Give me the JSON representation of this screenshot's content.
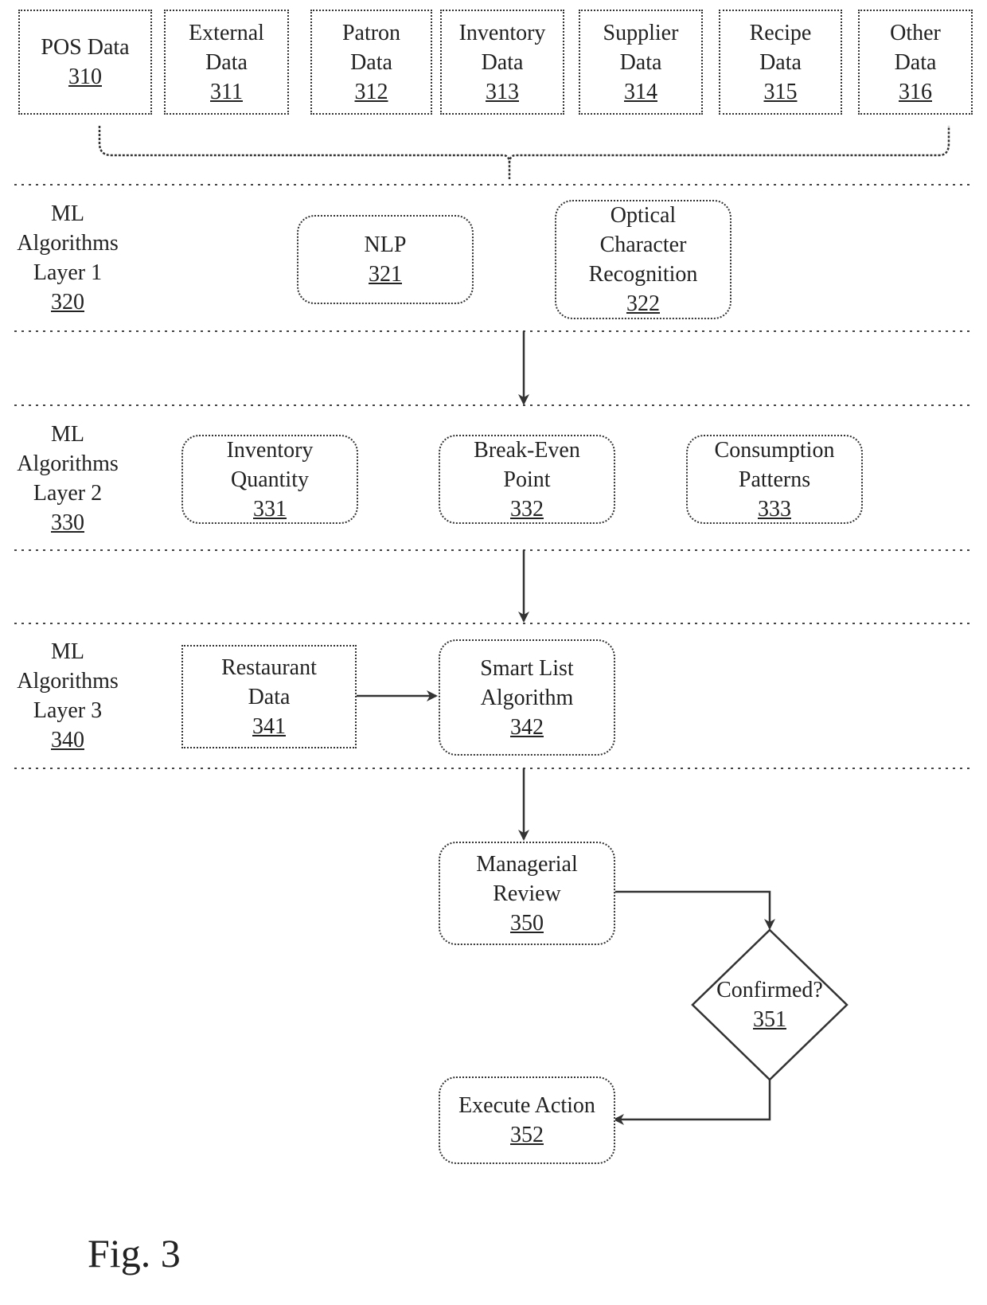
{
  "data_sources": [
    {
      "label": "POS Data",
      "ref": "310"
    },
    {
      "label": "External Data",
      "ref": "311"
    },
    {
      "label": "Patron Data",
      "ref": "312"
    },
    {
      "label": "Inventory Data",
      "ref": "313"
    },
    {
      "label": "Supplier Data",
      "ref": "314"
    },
    {
      "label": "Recipe Data",
      "ref": "315"
    },
    {
      "label": "Other Data",
      "ref": "316"
    }
  ],
  "layers": [
    {
      "line1": "ML",
      "line2": "Algorithms",
      "line3": "Layer 1",
      "ref": "320"
    },
    {
      "line1": "ML",
      "line2": "Algorithms",
      "line3": "Layer 2",
      "ref": "330"
    },
    {
      "line1": "ML",
      "line2": "Algorithms",
      "line3": "Layer 3",
      "ref": "340"
    }
  ],
  "layer1": {
    "nlp": {
      "label": "NLP",
      "ref": "321"
    },
    "ocr": {
      "line1": "Optical",
      "line2": "Character",
      "line3": "Recognition",
      "ref": "322"
    }
  },
  "layer2": {
    "inventory_quantity": {
      "line1": "Inventory",
      "line2": "Quantity",
      "ref": "331"
    },
    "break_even": {
      "line1": "Break-Even",
      "line2": "Point",
      "ref": "332"
    },
    "consumption": {
      "line1": "Consumption",
      "line2": "Patterns",
      "ref": "333"
    }
  },
  "layer3": {
    "restaurant_data": {
      "line1": "Restaurant",
      "line2": "Data",
      "ref": "341"
    },
    "smart_list": {
      "line1": "Smart List",
      "line2": "Algorithm",
      "ref": "342"
    }
  },
  "review": {
    "managerial": {
      "line1": "Managerial",
      "line2": "Review",
      "ref": "350"
    },
    "confirmed": {
      "label": "Confirmed?",
      "ref": "351"
    },
    "execute": {
      "label": "Execute Action",
      "ref": "352"
    }
  },
  "figure_label": "Fig. 3"
}
